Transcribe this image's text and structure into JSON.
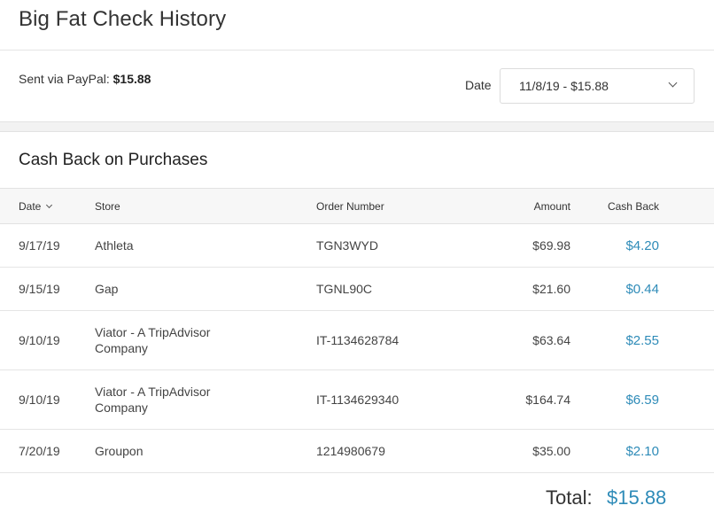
{
  "header": {
    "title": "Big Fat Check History"
  },
  "summary": {
    "sent_label": "Sent via PayPal:",
    "sent_amount": "$15.88",
    "date_label": "Date",
    "date_selected": "11/8/19 - $15.88"
  },
  "section": {
    "title": "Cash Back on Purchases"
  },
  "table": {
    "columns": [
      "Date",
      "Store",
      "Order Number",
      "Amount",
      "Cash Back"
    ],
    "rows": [
      {
        "date": "9/17/19",
        "store_line1": "Athleta",
        "store_line2": "",
        "order": "TGN3WYD",
        "amount": "$69.98",
        "cash_back": "$4.20"
      },
      {
        "date": "9/15/19",
        "store_line1": "Gap",
        "store_line2": "",
        "order": "TGNL90C",
        "amount": "$21.60",
        "cash_back": "$0.44"
      },
      {
        "date": "9/10/19",
        "store_line1": "Viator - A TripAdvisor",
        "store_line2": "Company",
        "order": "IT-1134628784",
        "amount": "$63.64",
        "cash_back": "$2.55"
      },
      {
        "date": "9/10/19",
        "store_line1": "Viator - A TripAdvisor",
        "store_line2": "Company",
        "order": "IT-1134629340",
        "amount": "$164.74",
        "cash_back": "$6.59"
      },
      {
        "date": "7/20/19",
        "store_line1": "Groupon",
        "store_line2": "",
        "order": "1214980679",
        "amount": "$35.00",
        "cash_back": "$2.10"
      }
    ]
  },
  "total": {
    "label": "Total:",
    "value": "$15.88"
  },
  "colors": {
    "accent": "#2e8bb8"
  }
}
